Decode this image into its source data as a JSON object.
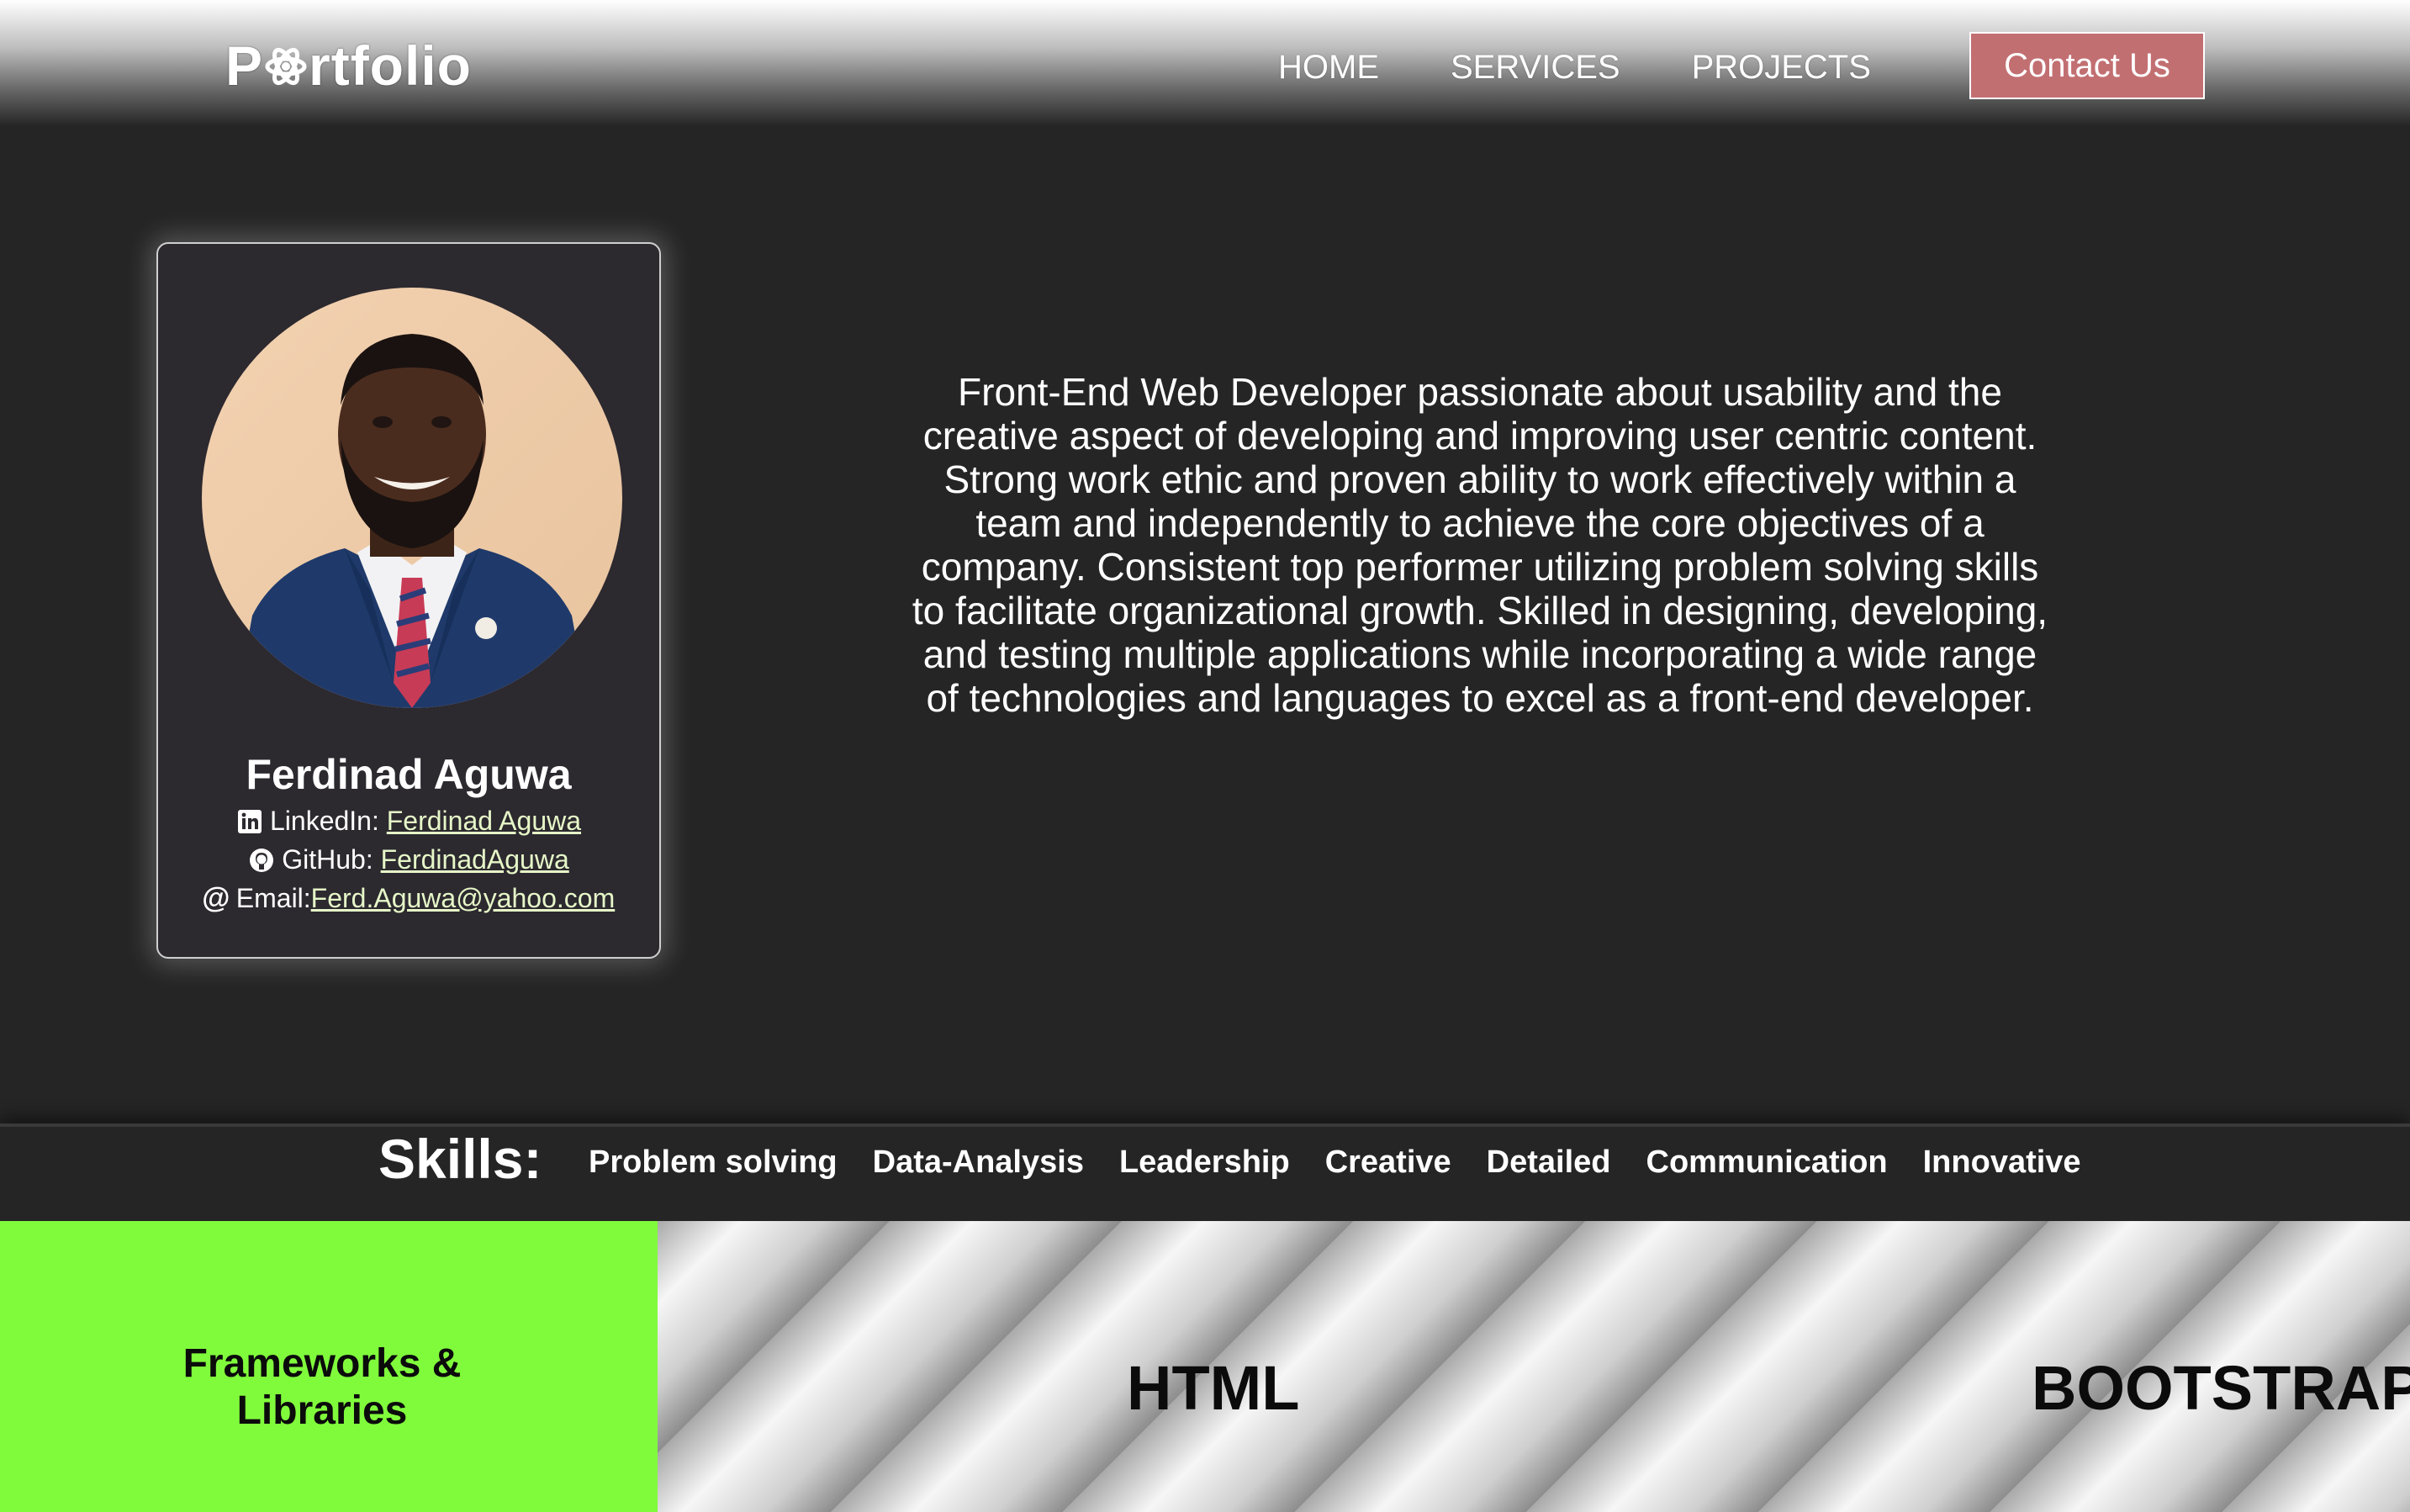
{
  "navbar": {
    "logo": "Portfolio",
    "logo_prefix": "P",
    "logo_suffix": "rtfolio",
    "links": [
      "HOME",
      "SERVICES",
      "PROJECTS"
    ],
    "contact_button": "Contact Us"
  },
  "profile": {
    "name": "Ferdinad Aguwa",
    "linkedin_label": "LinkedIn:",
    "linkedin_link": "Ferdinad Aguwa",
    "github_label": "GitHub:",
    "github_link": "FerdinadAguwa",
    "email_label": "Email:",
    "email_link": "Ferd.Aguwa@yahoo.com"
  },
  "bio": {
    "lines": [
      "Front-End Web Developer passionate about usability and the",
      "creative aspect of developing and improving user centric content.",
      "Strong work ethic and proven ability to work effectively within a",
      "team and independently to achieve the core objectives of a",
      "company. Consistent top performer utilizing problem solving skills",
      "to facilitate organizational growth. Skilled in designing, developing,",
      "and testing multiple applications while incorporating a wide range",
      "of technologies and languages to excel as a front-end developer."
    ]
  },
  "skills": {
    "title": "Skills:",
    "items": [
      "Problem solving",
      "Data-Analysis",
      "Leadership",
      "Creative",
      "Detailed",
      "Communication",
      "Innovative"
    ]
  },
  "frameworks": {
    "label_line1": "Frameworks &",
    "label_line2": "Libraries",
    "items": [
      "HTML",
      "BOOTSTRAP"
    ]
  },
  "colors": {
    "contact_button": "#c26f72",
    "frameworks_label_bg": "#80fb3c",
    "page_bg": "#252525",
    "card_bg": "#2c292f",
    "link_color": "#e6f7c8"
  },
  "icons": {
    "logo_o": "atom-icon",
    "linkedin": "linkedin-icon",
    "github": "github-icon",
    "email": "at-sign-icon"
  }
}
